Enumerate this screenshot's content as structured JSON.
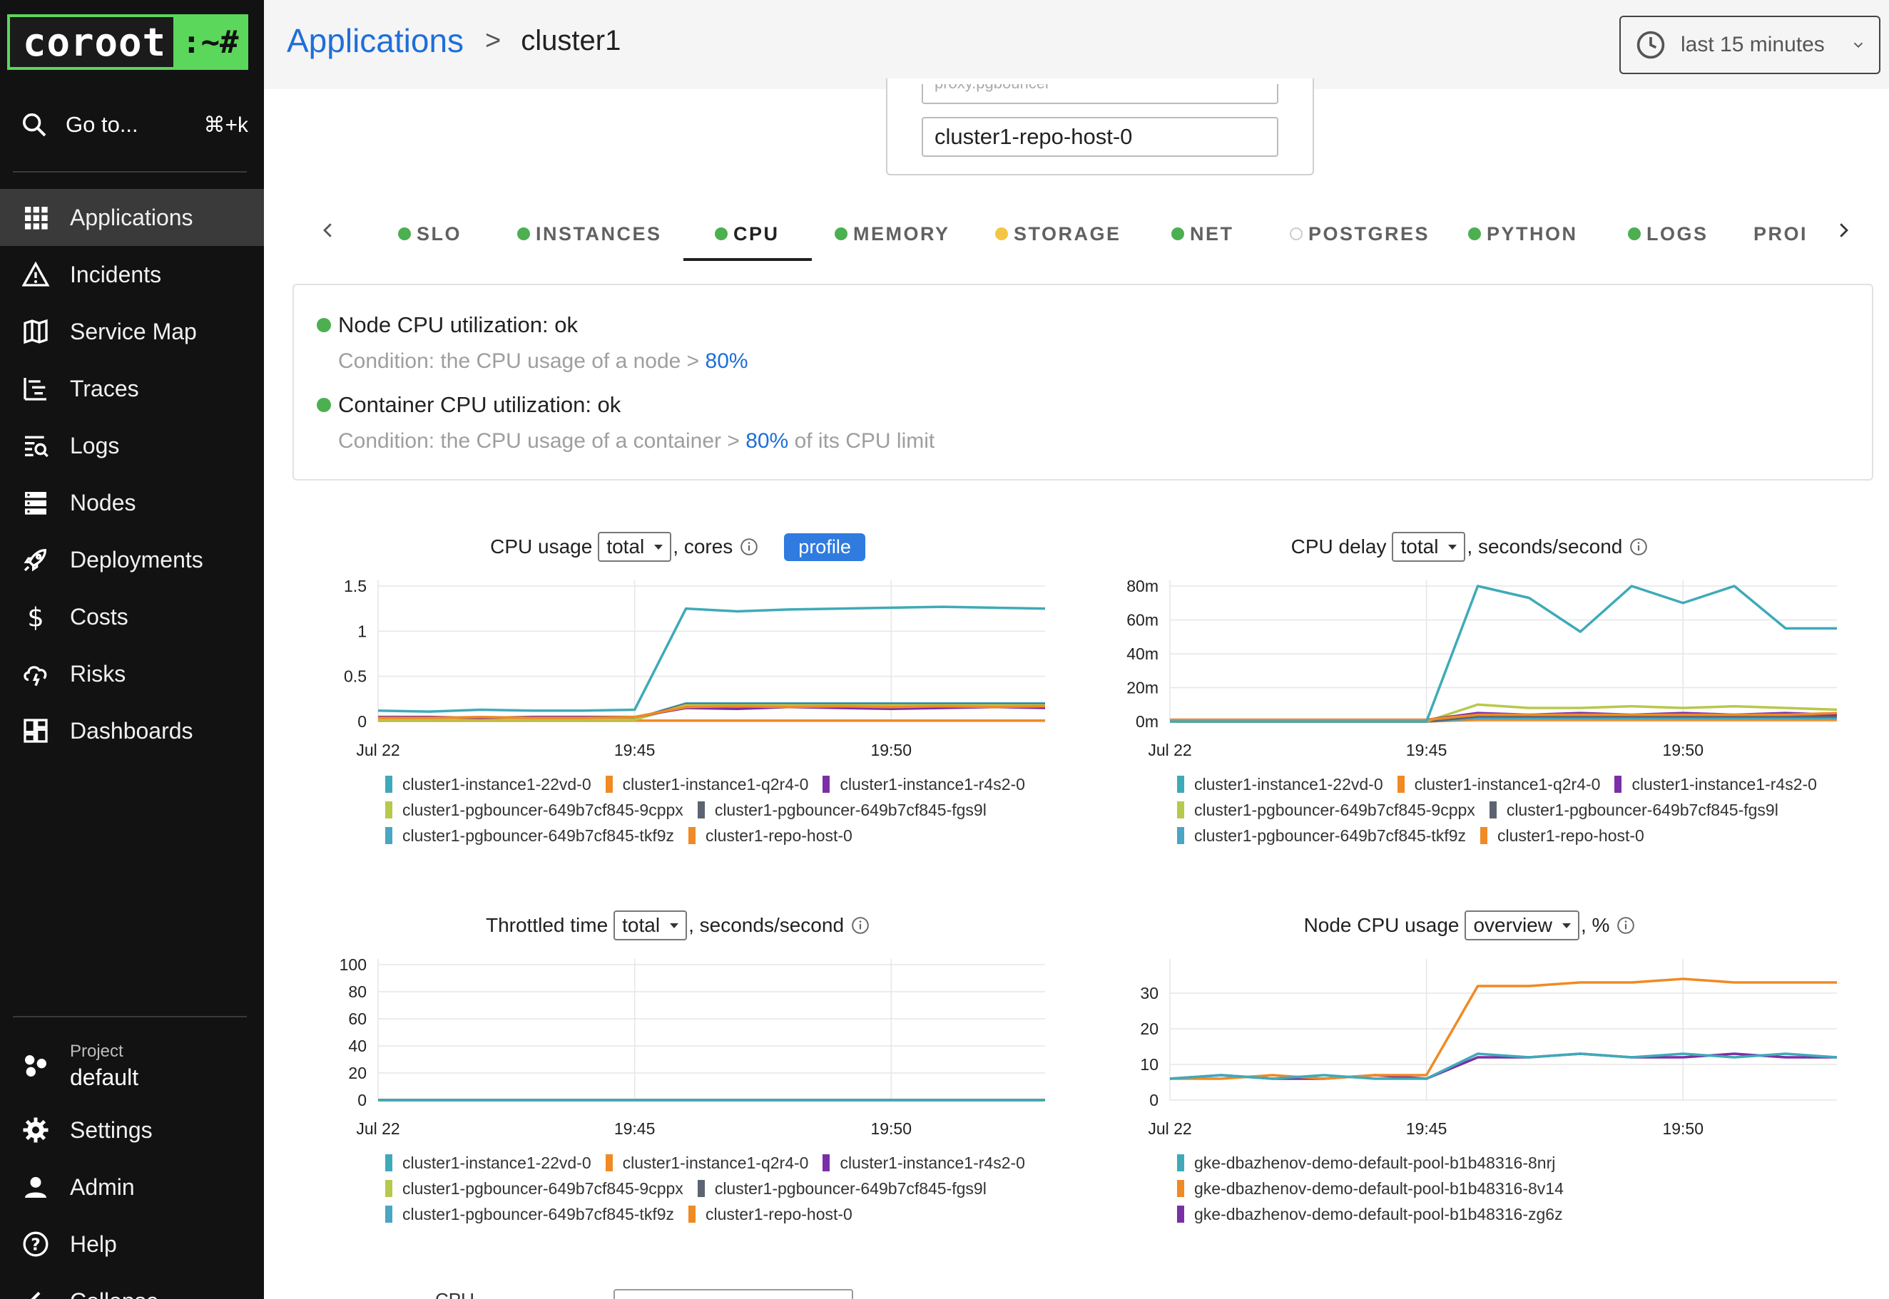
{
  "brand": {
    "name": "coroot",
    "prompt": ":~#"
  },
  "goto": {
    "label": "Go to...",
    "shortcut": "⌘+k"
  },
  "nav": [
    {
      "label": "Applications",
      "icon": "grid-icon",
      "active": true
    },
    {
      "label": "Incidents",
      "icon": "warning-icon"
    },
    {
      "label": "Service Map",
      "icon": "map-icon"
    },
    {
      "label": "Traces",
      "icon": "traces-icon"
    },
    {
      "label": "Logs",
      "icon": "logs-icon"
    },
    {
      "label": "Nodes",
      "icon": "server-icon"
    },
    {
      "label": "Deployments",
      "icon": "rocket-icon"
    },
    {
      "label": "Costs",
      "icon": "dollar-icon"
    },
    {
      "label": "Risks",
      "icon": "cloud-risk-icon"
    },
    {
      "label": "Dashboards",
      "icon": "dashboard-icon"
    }
  ],
  "project": {
    "label": "Project",
    "value": "default"
  },
  "bottom_nav": [
    {
      "label": "Settings",
      "icon": "gear-icon"
    },
    {
      "label": "Admin",
      "icon": "person-icon"
    },
    {
      "label": "Help",
      "icon": "help-icon"
    },
    {
      "label": "Collapse",
      "icon": "chevron-left-icon"
    }
  ],
  "header": {
    "breadcrumb_root": "Applications",
    "breadcrumb_sep": ">",
    "breadcrumb_current": "cluster1",
    "time_range": "last 15 minutes"
  },
  "instances": {
    "prev_item": "proxy.pgbouncer",
    "item": "cluster1-repo-host-0"
  },
  "tabs": [
    {
      "label": "SLO",
      "status": "#4caf50"
    },
    {
      "label": "INSTANCES",
      "status": "#4caf50"
    },
    {
      "label": "CPU",
      "status": "#4caf50",
      "active": true
    },
    {
      "label": "MEMORY",
      "status": "#4caf50"
    },
    {
      "label": "STORAGE",
      "status": "#f4c542"
    },
    {
      "label": "NET",
      "status": "#4caf50"
    },
    {
      "label": "POSTGRES",
      "status": "none"
    },
    {
      "label": "PYTHON",
      "status": "#4caf50"
    },
    {
      "label": "LOGS",
      "status": "#4caf50"
    },
    {
      "label": "PROI",
      "status": "cut"
    }
  ],
  "checks": [
    {
      "title": "Node CPU utilization: ok",
      "cond_pre": "Condition: the CPU usage of a node > ",
      "threshold": "80%",
      "cond_post": ""
    },
    {
      "title": "Container CPU utilization: ok",
      "cond_pre": "Condition: the CPU usage of a container > ",
      "threshold": "80%",
      "cond_post": " of its CPU limit"
    }
  ],
  "colors": {
    "c22vd": "#3eaab9",
    "cq2r4": "#f08a24",
    "cr4s2": "#7b2fa6",
    "c9cppx": "#b7c94a",
    "cfgs9l": "#5b6470",
    "ctkf9z": "#49a6c4",
    "crepo": "#f08a24",
    "n8nrj": "#3eaab9",
    "n8v14": "#f08a24",
    "nzg6z": "#7b2fa6"
  },
  "chart_ui": {
    "cpu_usage": {
      "title": "CPU usage",
      "select": "total",
      "unit": ", cores",
      "profile_label": "profile"
    },
    "cpu_delay": {
      "title": "CPU delay",
      "select": "total",
      "unit": ", seconds/second"
    },
    "throttled": {
      "title": "Throttled time",
      "select": "total",
      "unit": ", seconds/second"
    },
    "node_cpu": {
      "title": "Node CPU usage",
      "select": "overview",
      "unit": ", %"
    }
  },
  "bottom_partial": {
    "label": "CPU"
  },
  "chart_data": [
    {
      "type": "line",
      "title": "CPU usage",
      "x": [
        "19:40",
        "19:41",
        "19:42",
        "19:43",
        "19:44",
        "19:45",
        "19:46",
        "19:47",
        "19:48",
        "19:49",
        "19:50",
        "19:51",
        "19:52",
        "19:53"
      ],
      "x_ticks": [
        "Jul 22",
        "19:45",
        "19:50"
      ],
      "y_ticks": [
        "1.5",
        "1",
        "0.5",
        "0"
      ],
      "ylim": [
        0,
        1.5
      ],
      "series": [
        {
          "name": "cluster1-instance1-22vd-0",
          "color": "#3eaab9",
          "values": [
            0.12,
            0.11,
            0.13,
            0.12,
            0.12,
            0.13,
            1.25,
            1.22,
            1.24,
            1.25,
            1.26,
            1.27,
            1.26,
            1.25
          ]
        },
        {
          "name": "cluster1-instance1-q2r4-0",
          "color": "#f08a24",
          "values": [
            0.04,
            0.04,
            0.05,
            0.04,
            0.04,
            0.05,
            0.16,
            0.17,
            0.16,
            0.17,
            0.16,
            0.17,
            0.16,
            0.17
          ]
        },
        {
          "name": "cluster1-instance1-r4s2-0",
          "color": "#7b2fa6",
          "values": [
            0.05,
            0.05,
            0.04,
            0.05,
            0.05,
            0.05,
            0.15,
            0.14,
            0.16,
            0.15,
            0.14,
            0.15,
            0.16,
            0.15
          ]
        },
        {
          "name": "cluster1-pgbouncer-649b7cf845-9cppx",
          "color": "#b7c94a",
          "values": [
            0.02,
            0.02,
            0.02,
            0.02,
            0.02,
            0.02,
            0.18,
            0.18,
            0.18,
            0.18,
            0.18,
            0.18,
            0.18,
            0.18
          ]
        },
        {
          "name": "cluster1-pgbouncer-649b7cf845-fgs9l",
          "color": "#5b6470",
          "values": [
            0.03,
            0.03,
            0.03,
            0.03,
            0.03,
            0.03,
            0.19,
            0.19,
            0.19,
            0.19,
            0.19,
            0.19,
            0.19,
            0.19
          ]
        },
        {
          "name": "cluster1-pgbouncer-649b7cf845-tkf9z",
          "color": "#49a6c4",
          "values": [
            0.03,
            0.03,
            0.03,
            0.03,
            0.03,
            0.03,
            0.2,
            0.2,
            0.2,
            0.2,
            0.2,
            0.2,
            0.2,
            0.2
          ]
        },
        {
          "name": "cluster1-repo-host-0",
          "color": "#f08a24",
          "values": [
            0.01,
            0.01,
            0.01,
            0.01,
            0.01,
            0.01,
            0.01,
            0.01,
            0.01,
            0.01,
            0.01,
            0.01,
            0.01,
            0.01
          ]
        }
      ]
    },
    {
      "type": "line",
      "title": "CPU delay",
      "x": [
        "19:40",
        "19:41",
        "19:42",
        "19:43",
        "19:44",
        "19:45",
        "19:46",
        "19:47",
        "19:48",
        "19:49",
        "19:50",
        "19:51",
        "19:52",
        "19:53"
      ],
      "x_ticks": [
        "Jul 22",
        "19:45",
        "19:50"
      ],
      "y_ticks": [
        "80m",
        "60m",
        "40m",
        "20m",
        "0m"
      ],
      "ylim": [
        0,
        0.08
      ],
      "series": [
        {
          "name": "cluster1-instance1-22vd-0",
          "color": "#3eaab9",
          "values": [
            0,
            0,
            0,
            0,
            0,
            0,
            0.08,
            0.073,
            0.053,
            0.08,
            0.07,
            0.08,
            0.055,
            0.055
          ]
        },
        {
          "name": "cluster1-instance1-q2r4-0",
          "color": "#f08a24",
          "values": [
            0.001,
            0.001,
            0.001,
            0.001,
            0.001,
            0.001,
            0.004,
            0.004,
            0.004,
            0.004,
            0.004,
            0.004,
            0.004,
            0.005
          ]
        },
        {
          "name": "cluster1-instance1-r4s2-0",
          "color": "#7b2fa6",
          "values": [
            0.001,
            0.001,
            0.001,
            0.001,
            0.001,
            0.001,
            0.005,
            0.004,
            0.005,
            0.004,
            0.005,
            0.004,
            0.005,
            0.004
          ]
        },
        {
          "name": "cluster1-pgbouncer-649b7cf845-9cppx",
          "color": "#b7c94a",
          "values": [
            0,
            0,
            0,
            0,
            0,
            0,
            0.01,
            0.008,
            0.008,
            0.009,
            0.008,
            0.009,
            0.008,
            0.007
          ]
        },
        {
          "name": "cluster1-pgbouncer-649b7cf845-fgs9l",
          "color": "#5b6470",
          "values": [
            0,
            0,
            0,
            0,
            0,
            0,
            0.003,
            0.003,
            0.003,
            0.003,
            0.003,
            0.003,
            0.003,
            0.003
          ]
        },
        {
          "name": "cluster1-pgbouncer-649b7cf845-tkf9z",
          "color": "#49a6c4",
          "values": [
            0,
            0,
            0,
            0,
            0,
            0,
            0.002,
            0.002,
            0.002,
            0.002,
            0.002,
            0.002,
            0.002,
            0.002
          ]
        },
        {
          "name": "cluster1-repo-host-0",
          "color": "#f08a24",
          "values": [
            0,
            0,
            0,
            0,
            0,
            0,
            0.001,
            0.001,
            0.001,
            0.001,
            0.001,
            0.001,
            0.001,
            0.001
          ]
        }
      ]
    },
    {
      "type": "line",
      "title": "Throttled time",
      "x": [
        "19:40",
        "19:41",
        "19:42",
        "19:43",
        "19:44",
        "19:45",
        "19:46",
        "19:47",
        "19:48",
        "19:49",
        "19:50",
        "19:51",
        "19:52",
        "19:53"
      ],
      "x_ticks": [
        "Jul 22",
        "19:45",
        "19:50"
      ],
      "y_ticks": [
        "100",
        "80",
        "60",
        "40",
        "20",
        "0"
      ],
      "ylim": [
        0,
        100
      ],
      "series": [
        {
          "name": "cluster1-instance1-22vd-0",
          "color": "#3eaab9",
          "values": [
            0,
            0,
            0,
            0,
            0,
            0,
            0,
            0,
            0,
            0,
            0,
            0,
            0,
            0
          ]
        },
        {
          "name": "cluster1-instance1-q2r4-0",
          "color": "#f08a24",
          "values": [
            0,
            0,
            0,
            0,
            0,
            0,
            0,
            0,
            0,
            0,
            0,
            0,
            0,
            0
          ]
        },
        {
          "name": "cluster1-instance1-r4s2-0",
          "color": "#7b2fa6",
          "values": [
            0,
            0,
            0,
            0,
            0,
            0,
            0,
            0,
            0,
            0,
            0,
            0,
            0,
            0
          ]
        },
        {
          "name": "cluster1-pgbouncer-649b7cf845-9cppx",
          "color": "#b7c94a",
          "values": [
            0,
            0,
            0,
            0,
            0,
            0,
            0,
            0,
            0,
            0,
            0,
            0,
            0,
            0
          ]
        },
        {
          "name": "cluster1-pgbouncer-649b7cf845-fgs9l",
          "color": "#5b6470",
          "values": [
            0,
            0,
            0,
            0,
            0,
            0,
            0,
            0,
            0,
            0,
            0,
            0,
            0,
            0
          ]
        },
        {
          "name": "cluster1-pgbouncer-649b7cf845-tkf9z",
          "color": "#49a6c4",
          "values": [
            0,
            0,
            0,
            0,
            0,
            0,
            0,
            0,
            0,
            0,
            0,
            0,
            0,
            0
          ]
        },
        {
          "name": "cluster1-repo-host-0",
          "color": "#f08a24",
          "values": [
            0,
            0,
            0,
            0,
            0,
            0,
            0,
            0,
            0,
            0,
            0,
            0,
            0,
            0
          ]
        }
      ]
    },
    {
      "type": "line",
      "title": "Node CPU usage",
      "x": [
        "19:40",
        "19:41",
        "19:42",
        "19:43",
        "19:44",
        "19:45",
        "19:46",
        "19:47",
        "19:48",
        "19:49",
        "19:50",
        "19:51",
        "19:52",
        "19:53"
      ],
      "x_ticks": [
        "Jul 22",
        "19:45",
        "19:50"
      ],
      "y_ticks": [
        "30",
        "20",
        "10",
        "0"
      ],
      "ylim": [
        0,
        38
      ],
      "series": [
        {
          "name": "gke-dbazhenov-demo-default-pool-b1b48316-8nrj",
          "color": "#3eaab9",
          "values": [
            6,
            7,
            6,
            7,
            6,
            6,
            13,
            12,
            13,
            12,
            13,
            12,
            13,
            12
          ]
        },
        {
          "name": "gke-dbazhenov-demo-default-pool-b1b48316-8v14",
          "color": "#f08a24",
          "values": [
            6,
            6,
            7,
            6,
            7,
            7,
            32,
            32,
            33,
            33,
            34,
            33,
            33,
            33
          ]
        },
        {
          "name": "gke-dbazhenov-demo-default-pool-b1b48316-zg6z",
          "color": "#7b2fa6",
          "values": [
            6,
            7,
            6,
            6,
            7,
            6,
            12,
            12,
            13,
            12,
            12,
            13,
            12,
            12
          ]
        }
      ]
    }
  ]
}
